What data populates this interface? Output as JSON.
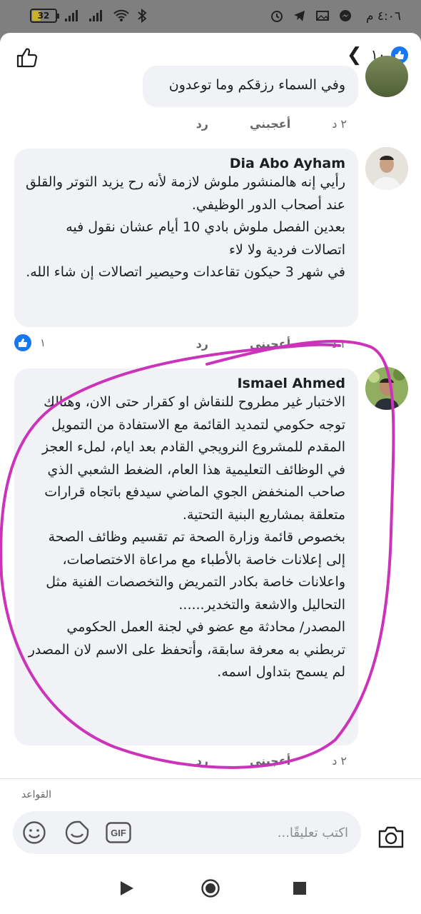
{
  "status_bar": {
    "time": "٤:٠٦ م",
    "battery": "32"
  },
  "header": {
    "reaction_count": "١٠"
  },
  "comments": [
    {
      "author": "",
      "text": "وفي السماء رزقكم وما توعدون",
      "time": "٢ د",
      "like_label": "أعجبني",
      "reply_label": "رد"
    },
    {
      "author": "Dia Abo Ayham",
      "text": "رأيي إنه هالمنشور ملوش لازمة لأنه رح يزيد التوتر والقلق عند أصحاب الدور الوظيفي.\nبعدين الفصل ملوش بادي 10 أيام عشان نقول فيه اتصالات فردية ولا لاء\nفي شهر 3 حيكون تقاعدات وحيصير اتصالات إن شاء الله.",
      "time": "٢ د",
      "like_label": "أعجبني",
      "reply_label": "رد",
      "reactions": "١"
    },
    {
      "author": "Ismael Ahmed",
      "text": "الاختبار غير مطروح للنقاش او كقرار  حتى الان، وهنالك توجه حكومي لتمديد القائمة مع الاستفادة من التمويل المقدم للمشروع النرويجي القادم بعد ايام، لملء العجز في الوظائف التعليمية هذا العام، الضغط الشعبي الذي صاحب المنخفض الجوي الماضي سيدفع باتجاه قرارات متعلقة بمشاريع البنية التحتية.\nبخصوص قائمة وزارة الصحة تم تقسيم وظائف الصحة إلى إعلانات خاصة بالأطباء مع مراعاة الاختصاصات، واعلانات خاصة بكادر التمريض والتخصصات الفنية مثل التحاليل والاشعة والتخدير......\nالمصدر/ محادثة مع عضو في لجنة العمل الحكومي تربطني به معرفة سابقة، وأتحفظ على الاسم لان المصدر لم يسمح بتداول اسمه.",
      "time": "٢ د",
      "like_label": "أعجبني",
      "reply_label": "رد"
    }
  ],
  "footer": {
    "rules_label": "القواعد",
    "comment_placeholder": "اكتب تعليقًا...",
    "gif_label": "GIF"
  },
  "colors": {
    "accent": "#1877f2",
    "bubble": "#f0f2f5",
    "annotation": "#cc33bb"
  }
}
